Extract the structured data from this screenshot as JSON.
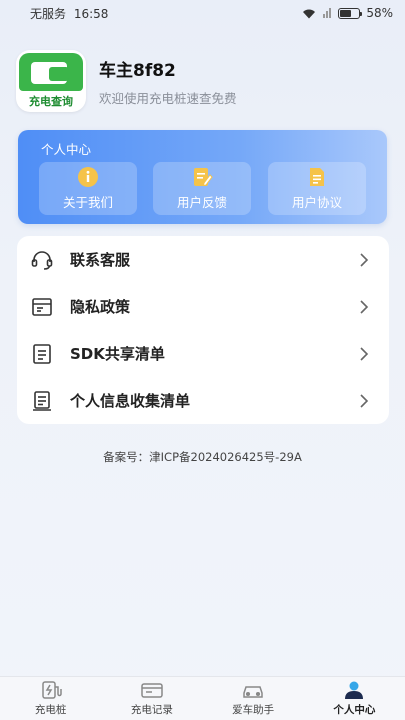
{
  "status_bar": {
    "carrier": "无服务",
    "time": "16:58",
    "battery": "58%",
    "battery_level": 0.58
  },
  "profile": {
    "logo_text": "充电查询",
    "username": "车主8f82",
    "subtitle": "欢迎使用充电桩速查免费"
  },
  "personal_center": {
    "title": "个人中心",
    "buttons": [
      {
        "label": "关于我们",
        "icon": "info-icon"
      },
      {
        "label": "用户反馈",
        "icon": "feedback-edit-icon"
      },
      {
        "label": "用户协议",
        "icon": "document-icon"
      }
    ]
  },
  "menu": {
    "items": [
      {
        "label": "联系客服",
        "icon": "headset-icon"
      },
      {
        "label": "隐私政策",
        "icon": "policy-icon"
      },
      {
        "label": "SDK共享清单",
        "icon": "list-icon"
      },
      {
        "label": "个人信息收集清单",
        "icon": "clipboard-list-icon"
      }
    ]
  },
  "icp": "备案号：津ICP备2024026425号-29A",
  "tabbar": {
    "tabs": [
      {
        "label": "充电桩",
        "icon": "charging-pile-icon",
        "active": false
      },
      {
        "label": "充电记录",
        "icon": "records-icon",
        "active": false
      },
      {
        "label": "爱车助手",
        "icon": "car-icon",
        "active": false
      },
      {
        "label": "个人中心",
        "icon": "user-icon",
        "active": true
      }
    ]
  },
  "colors": {
    "accent_blue": "#4f8ef6",
    "brand_green": "#3bb54a",
    "active_tab": "#35a6e8"
  }
}
